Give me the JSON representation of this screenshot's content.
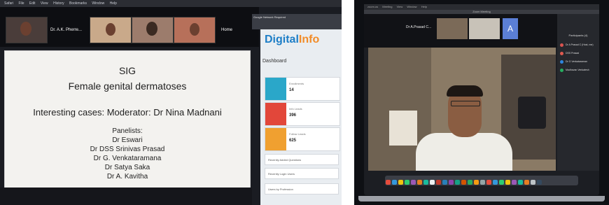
{
  "left_photo": {
    "menubar": [
      "Safari",
      "File",
      "Edit",
      "View",
      "History",
      "Bookmarks",
      "Window",
      "Help"
    ],
    "participant_label": "Dr. A.K. Pherre...",
    "host_label": "Home",
    "notification": "Google Network Required",
    "brand": {
      "main": "Digital",
      "accent": "Info"
    },
    "dashboard_label": "Dashboard",
    "cards": [
      {
        "label": "Enrollments",
        "value": "14",
        "color": "#2aa7c9"
      },
      {
        "label": "Info Leads",
        "value": "396",
        "color": "#e2473a"
      },
      {
        "label": "Follow Leads",
        "value": "625",
        "color": "#f0a030"
      }
    ],
    "nav_rows": [
      "Recently Added Questions",
      "Recently Login Users",
      "Users by Profession"
    ],
    "slide": {
      "title_line1": "SIG",
      "title_line2": "Female genital dermatoses",
      "subtitle": "Interesting cases: Moderator: Dr Nina Madnani",
      "panelists_heading": "Panelists:",
      "panelists": [
        "Dr Eswari",
        "Dr DSS Srinivas Prasad",
        "Dr G. Venkataramana",
        "Dr Satya Saka",
        "Dr A. Kavitha"
      ]
    }
  },
  "right_photo": {
    "menubar": [
      "zoom.us",
      "Meeting",
      "View",
      "Window",
      "Help"
    ],
    "window_title": "Zoom Meeting",
    "tile_label": "Dr A.Prasad C...",
    "avatar_letter": "A",
    "participants_title": "Participants (4)",
    "participants": [
      {
        "name": "Dr A Prasad C (Host, me)",
        "color": "#d9534f"
      },
      {
        "name": "DSS Prasad",
        "color": "#e05a4f"
      },
      {
        "name": "Dr G Venkataraman",
        "color": "#2e86de"
      },
      {
        "name": "Madhavan Venkatesh",
        "color": "#27ae60"
      }
    ]
  }
}
